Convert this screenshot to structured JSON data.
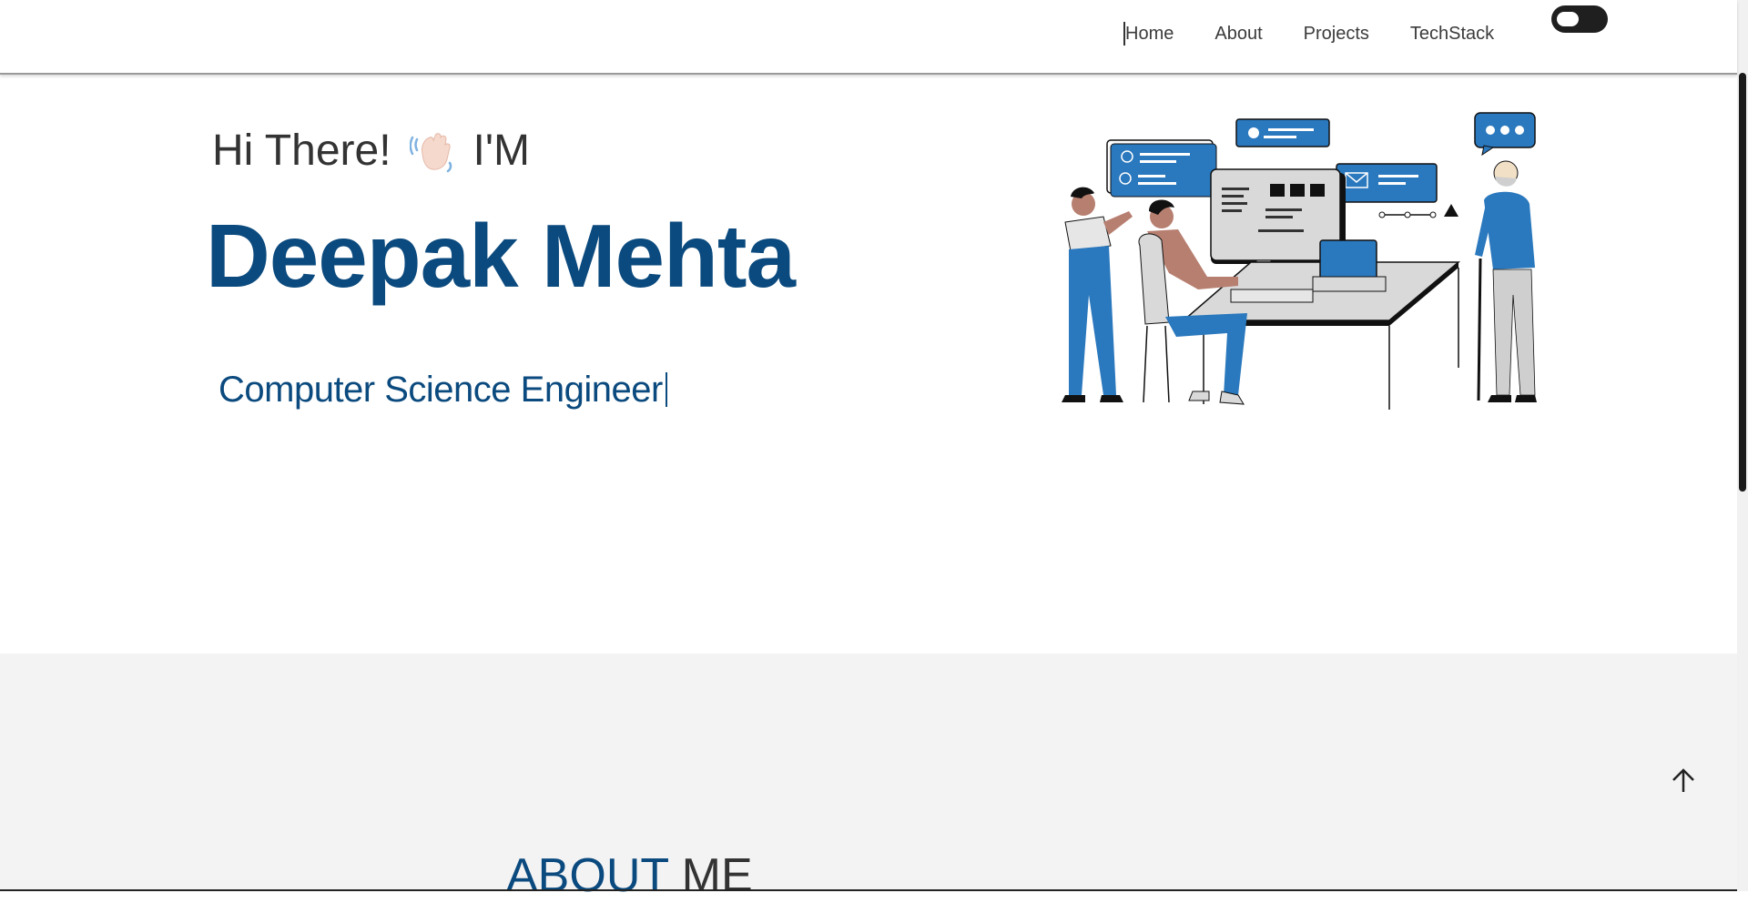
{
  "nav": {
    "links": [
      "Home",
      "About",
      "Projects",
      "TechStack"
    ]
  },
  "hero": {
    "greeting_prefix": "Hi There!",
    "greeting_suffix": "I'M",
    "name": "Deepak Mehta",
    "typed_text": "Computer Science Engineer"
  },
  "about": {
    "title_accent": "ABOUT",
    "title_rest": "ME"
  },
  "colors": {
    "brand_blue": "#0b4a7e",
    "illustration_blue": "#2a78bd",
    "section_bg": "#f4f3f4"
  },
  "icons": {
    "wave": "waving-hand-icon",
    "back_to_top": "arrow-up-icon",
    "toggle": "theme-toggle"
  }
}
